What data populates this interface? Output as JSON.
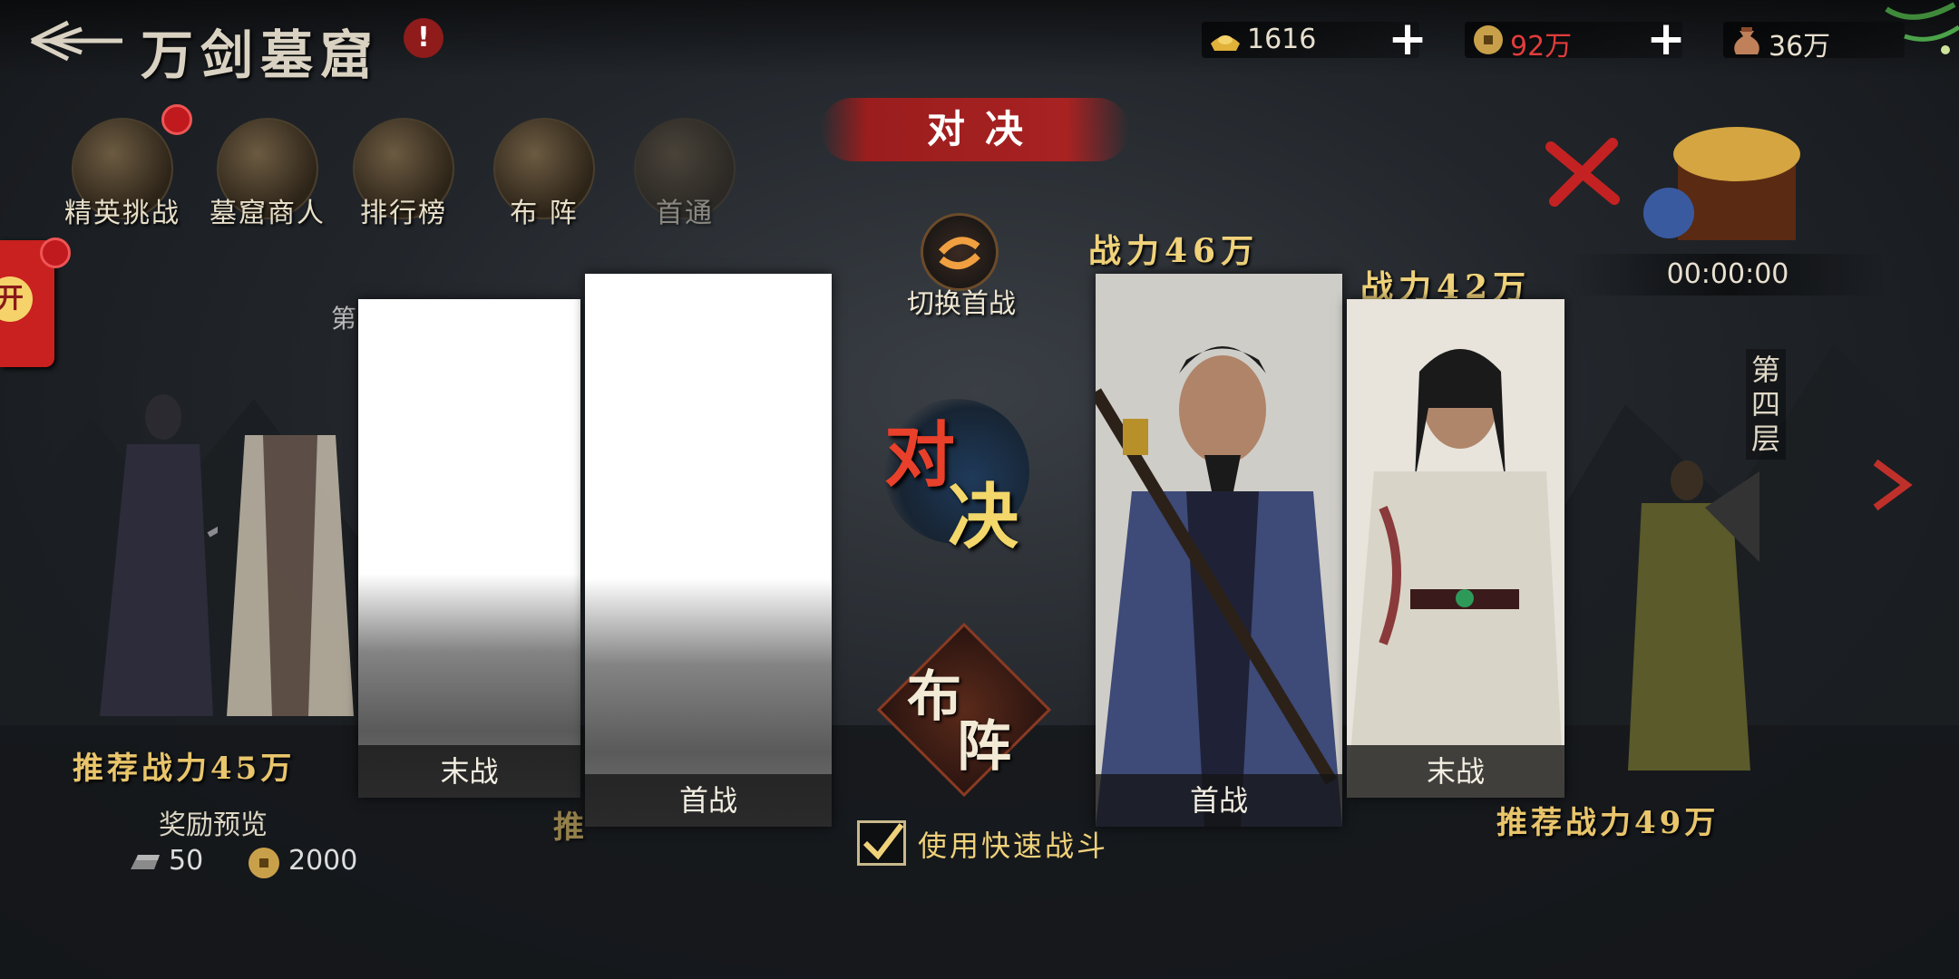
{
  "header": {
    "title": "万剑墓窟",
    "alert": "!"
  },
  "resources": [
    {
      "icon": "gold-ingot-icon",
      "value": "1616",
      "color": "#e8e0cf"
    },
    {
      "icon": "copper-coin-icon",
      "value": "92万",
      "color": "#e23c3c"
    },
    {
      "icon": "money-bag-icon",
      "value": "36万",
      "color": "#e8e0cf"
    }
  ],
  "menu": [
    {
      "label": "精英挑战",
      "icon": "elite-challenge-icon"
    },
    {
      "label": "墓窟商人",
      "icon": "tomb-merchant-icon"
    },
    {
      "label": "排行榜",
      "icon": "leaderboard-icon"
    },
    {
      "label": "布  阵",
      "icon": "formation-compass-icon"
    },
    {
      "label": "首通",
      "icon": "first-clear-chest-icon"
    }
  ],
  "side_event": {
    "label": "开"
  },
  "duel": {
    "banner": "对决",
    "switch_label": "切换首战",
    "vs_label_1": "对",
    "vs_label_2": "决",
    "formation_label_1": "布",
    "formation_label_2": "阵",
    "quick_battle": "使用快速战斗",
    "quick_battle_checked": true
  },
  "left_floor": {
    "floor_label": "第",
    "recommended_power": "推荐战力45万",
    "reward_title": "奖励预览",
    "rewards": [
      {
        "icon": "iron-ingot-icon",
        "value": "50"
      },
      {
        "icon": "copper-coin-icon",
        "value": "2000"
      }
    ],
    "behind_rec": "推"
  },
  "my_slots": [
    {
      "caption": "末战"
    },
    {
      "caption": "首战"
    }
  ],
  "enemy_slots": [
    {
      "power": "战力46万",
      "caption": "首战"
    },
    {
      "power": "战力42万",
      "caption": "末战"
    }
  ],
  "right_floor": {
    "floor_label": "第四层",
    "recommended_power": "推荐战力49万"
  },
  "chest": {
    "timer": "00:00:00"
  },
  "colors": {
    "accent_red": "#a82222",
    "gold": "#f0d27a",
    "coin_red": "#e23c3c"
  }
}
